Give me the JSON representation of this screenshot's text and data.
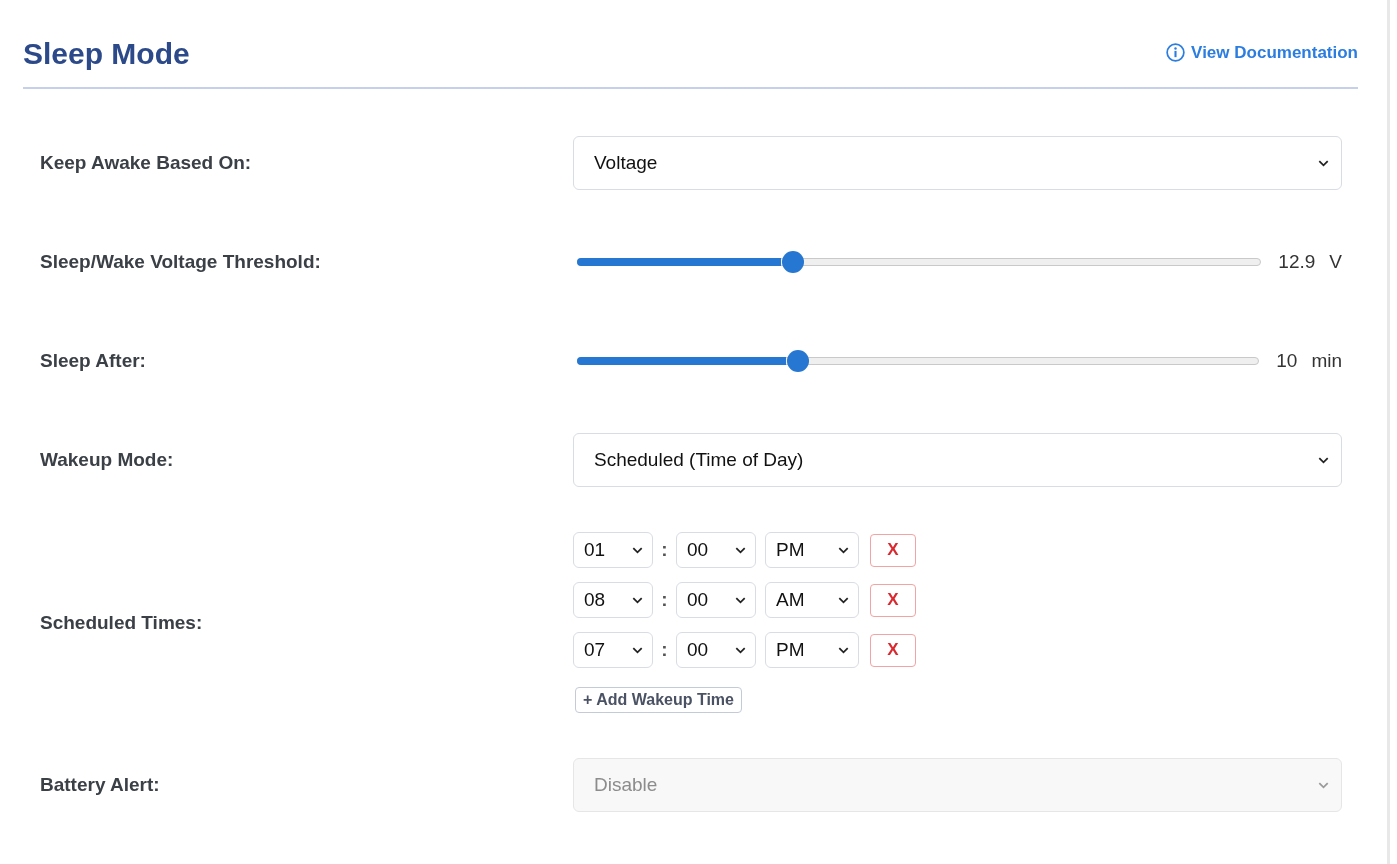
{
  "header": {
    "title": "Sleep Mode",
    "link": "View Documentation"
  },
  "fields": [
    {
      "kind": "select",
      "label": "Keep Awake Based On:",
      "value": "Voltage",
      "disabled": false
    },
    {
      "kind": "slider",
      "label": "Sleep/Wake Voltage Threshold:",
      "level": 0.315,
      "reading": "12.9",
      "unit": "V"
    },
    {
      "kind": "slider",
      "label": "Sleep After:",
      "level": 0.324,
      "reading": "10",
      "unit": "min"
    },
    {
      "kind": "select",
      "label": "Wakeup Mode:",
      "value": "Scheduled (Time of Day)",
      "disabled": false
    },
    {
      "kind": "schedule",
      "label": "Scheduled Times:",
      "times": [
        {
          "hour": "01",
          "separator": ":",
          "minute": "00",
          "period": "PM",
          "remove": "X"
        },
        {
          "hour": "08",
          "separator": ":",
          "minute": "00",
          "period": "AM",
          "remove": "X"
        },
        {
          "hour": "07",
          "separator": ":",
          "minute": "00",
          "period": "PM",
          "remove": "X"
        }
      ],
      "add_button": "+ Add Wakeup Time"
    },
    {
      "kind": "select",
      "label": "Battery Alert:",
      "value": "Disable",
      "disabled": true
    }
  ]
}
